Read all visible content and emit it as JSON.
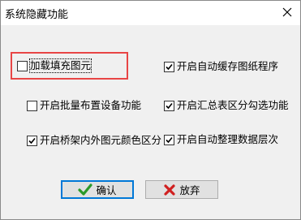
{
  "window": {
    "title": "系统隐藏功能"
  },
  "options": [
    {
      "id": "load-fill",
      "label": "加载填充图元",
      "checked": false
    },
    {
      "id": "auto-cache",
      "label": "开启自动缓存图纸程序",
      "checked": true
    },
    {
      "id": "batch-device",
      "label": "开启批量布置设备功能",
      "checked": false
    },
    {
      "id": "summary-select",
      "label": "开启汇总表区分勾选功能",
      "checked": true
    },
    {
      "id": "bridge-color",
      "label": "开启桥架内外图元颜色区分",
      "checked": true
    },
    {
      "id": "auto-layer",
      "label": "开启自动整理数据层次",
      "checked": true
    }
  ],
  "buttons": {
    "ok_label": "确认",
    "cancel_label": "放弃"
  },
  "colors": {
    "highlight": "#e84545",
    "ok_icon": "#2a9a2a",
    "cancel_icon": "#d02020"
  }
}
